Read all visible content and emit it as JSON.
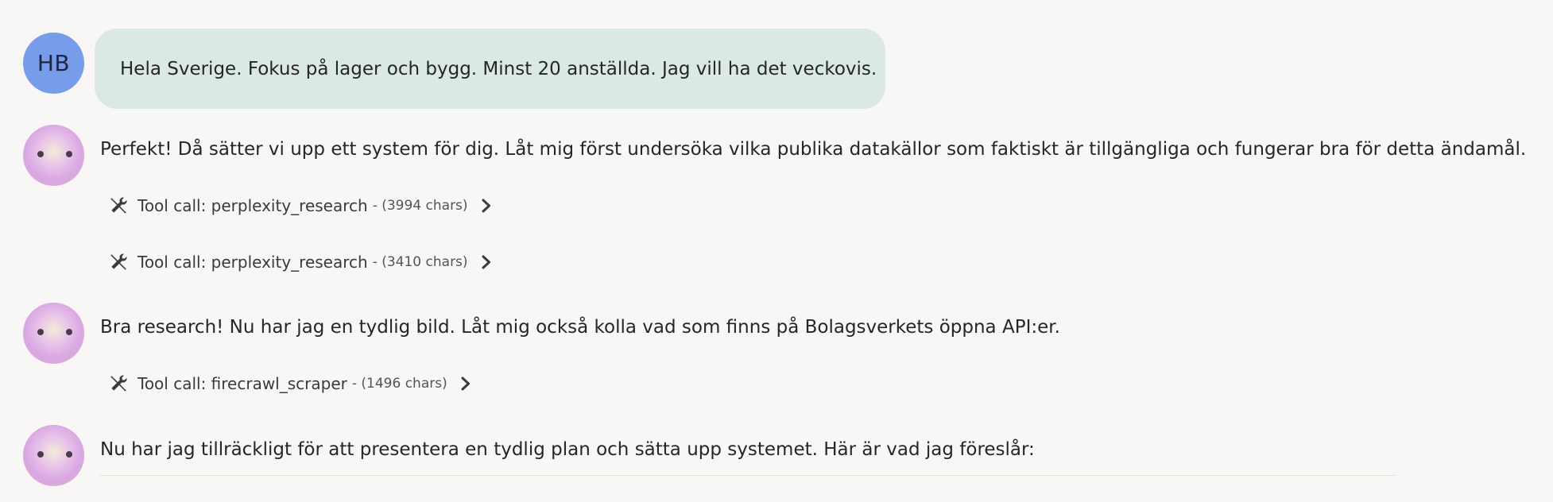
{
  "user": {
    "initials": "HB",
    "message": "Hela Sverige. Fokus på lager och bygg. Minst 20 anställda. Jag vill ha det veckovis."
  },
  "assistant": {
    "messages": [
      "Perfekt! Då sätter vi upp ett system för dig. Låt mig först undersöka vilka publika datakällor som faktiskt är tillgängliga och fungerar bra för detta ändamål.",
      "Bra research! Nu har jag en tydlig bild. Låt mig också kolla vad som finns på Bolagsverkets öppna API:er.",
      "Nu har jag tillräckligt för att presentera en tydlig plan och sätta upp systemet. Här är vad jag föreslår:"
    ],
    "tool_calls": [
      {
        "label": "Tool call: perplexity_research",
        "meta": "- (3994 chars)"
      },
      {
        "label": "Tool call: perplexity_research",
        "meta": "- (3410 chars)"
      },
      {
        "label": "Tool call: firecrawl_scraper",
        "meta": "- (1496 chars)"
      }
    ]
  },
  "icons": {
    "tool": "tools-icon",
    "expand": "chevron-right-icon"
  },
  "colors": {
    "user_avatar": "#779ce9",
    "user_bubble": "#dbe9e4",
    "background": "#f8f7f5"
  }
}
